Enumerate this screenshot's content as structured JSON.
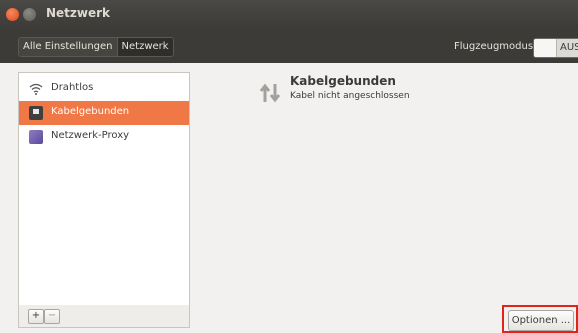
{
  "window": {
    "title": "Netzwerk"
  },
  "toolbar": {
    "breadcrumbs": [
      "Alle Einstellungen",
      "Netzwerk"
    ],
    "airplane_mode_label": "Flugzeugmodus",
    "airplane_toggle_state": "AUS"
  },
  "sidebar": {
    "items": [
      {
        "label": "Drahtlos",
        "icon": "wifi-icon",
        "selected": false
      },
      {
        "label": "Kabelgebunden",
        "icon": "wired-network-icon",
        "selected": true
      },
      {
        "label": "Netzwerk-Proxy",
        "icon": "network-proxy-icon",
        "selected": false
      }
    ],
    "add_label": "+",
    "remove_label": "−"
  },
  "detail": {
    "device_name": "Kabelgebunden",
    "status": "Kabel nicht angeschlossen",
    "icon": "network-transfer-icon",
    "options_label": "Optionen ..."
  },
  "colors": {
    "accent": "#f07746",
    "highlight_border": "#e0241b"
  }
}
